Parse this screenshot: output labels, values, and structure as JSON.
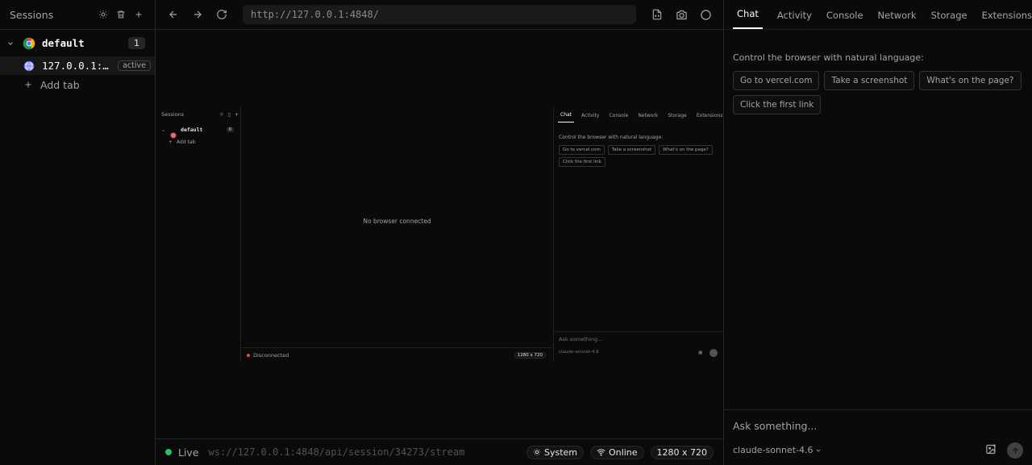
{
  "sidebar": {
    "title": "Sessions",
    "session": {
      "name": "default",
      "count": "1"
    },
    "tab": {
      "title": "127.0.0.1:48...",
      "badge": "active"
    },
    "add_tab": "Add tab"
  },
  "toolbar": {
    "url": "http://127.0.0.1:4848/"
  },
  "viewport_preview": {
    "sidebar_title": "Sessions",
    "session_name": "default",
    "session_count": "0",
    "add_tab": "Add tab",
    "message": "No browser connected",
    "status": "Disconnected",
    "size": "1280 x 720",
    "tabs": [
      "Chat",
      "Activity",
      "Console",
      "Network",
      "Storage",
      "Extensions"
    ],
    "intro": "Control the browser with natural language:",
    "suggestions": [
      "Go to vercel.com",
      "Take a screenshot",
      "What's on the page?",
      "Click the first link"
    ],
    "input_placeholder": "Ask something...",
    "model": "claude-sonnet-4.6"
  },
  "statusbar": {
    "live": "Live",
    "ws_url": "ws://127.0.0.1:4848/api/session/34273/stream",
    "theme": "System",
    "network": "Online",
    "size": "1280 x 720"
  },
  "panel": {
    "tabs": [
      "Chat",
      "Activity",
      "Console",
      "Network",
      "Storage",
      "Extensions"
    ],
    "intro": "Control the browser with natural language:",
    "suggestions": [
      "Go to vercel.com",
      "Take a screenshot",
      "What's on the page?",
      "Click the first link"
    ],
    "input_placeholder": "Ask something...",
    "model": "claude-sonnet-4.6"
  },
  "colors": {
    "live": "#22c55e",
    "disconnected": "#ef4444",
    "background": "#0a0a0a"
  },
  "icons": [
    "sun-icon",
    "trash-icon",
    "plus-icon",
    "chevron-down-icon",
    "chrome-icon",
    "globe-icon",
    "arrow-left-icon",
    "arrow-right-icon",
    "reload-icon",
    "file-code-icon",
    "camera-icon",
    "circle-icon",
    "wifi-icon",
    "image-icon",
    "arrow-up-icon"
  ]
}
